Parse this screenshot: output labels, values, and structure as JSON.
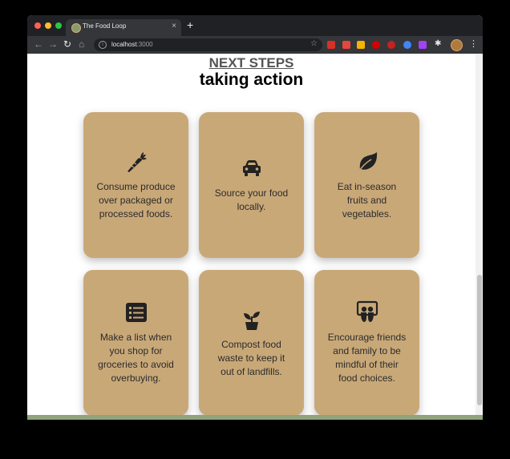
{
  "browser": {
    "tab_title": "The Food Loop",
    "tab_close": "×",
    "new_tab": "+",
    "url_host": "localhost",
    "url_port": ":3000",
    "nav": {
      "back": "←",
      "forward": "→",
      "reload": "↻",
      "home": "⌂"
    },
    "star": "☆",
    "puzzle": "✱",
    "menu": "⋮"
  },
  "page": {
    "eyebrow": "NEXT STEPS",
    "heading": "taking action",
    "cards": [
      {
        "icon": "carrot-icon",
        "text": "Consume produce over packaged or processed foods."
      },
      {
        "icon": "car-icon",
        "text": "Source your food locally."
      },
      {
        "icon": "leaf-icon",
        "text": "Eat in-season fruits and vegetables."
      },
      {
        "icon": "list-icon",
        "text": "Make a list when you shop for groceries to avoid overbuying."
      },
      {
        "icon": "seedling-icon",
        "text": "Compost food waste to keep it out of landfills."
      },
      {
        "icon": "slideshare-icon",
        "text": "Encourage friends and family to be mindful of their food choices."
      }
    ]
  },
  "colors": {
    "card_bg": "#c9a878",
    "footer": "#8fa47c",
    "icon": "#222222"
  }
}
